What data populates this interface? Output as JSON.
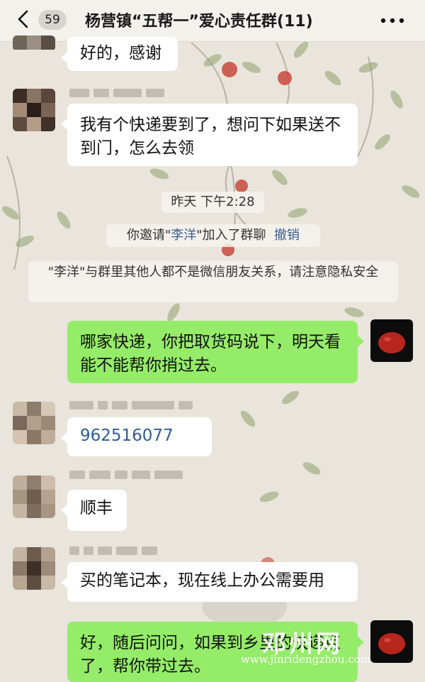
{
  "header": {
    "unread_count": "59",
    "title": "杨营镇“五帮一”爱心责任群(11)"
  },
  "messages": {
    "m1": "好的，感谢",
    "m2": "我有个快递要到了，想问下如果送不到门，怎么去领",
    "timestamp": "昨天 下午2:28",
    "invite_prefix": "你邀请\"",
    "invite_name": "李洋",
    "invite_suffix": "\"加入了群聊",
    "invite_undo": "撤销",
    "privacy_notice": "\"李洋\"与群里其他人都不是微信朋友关系，请注意隐私安全",
    "m3": "哪家快递，你把取货码说下，明天看能不能帮你捎过去。",
    "m4": "962516077",
    "m5": "顺丰",
    "m6": "买的笔记本，现在线上办公需要用",
    "m7": "好，随后问问，如果到乡里的快递点了，帮你带过去。"
  },
  "watermark": {
    "site_cn": "邓州网",
    "site_url": "www.jinridengzhou.com"
  },
  "colors": {
    "self_bubble": "#95ec69",
    "other_bubble": "#ffffff",
    "link": "#3b5f91"
  }
}
